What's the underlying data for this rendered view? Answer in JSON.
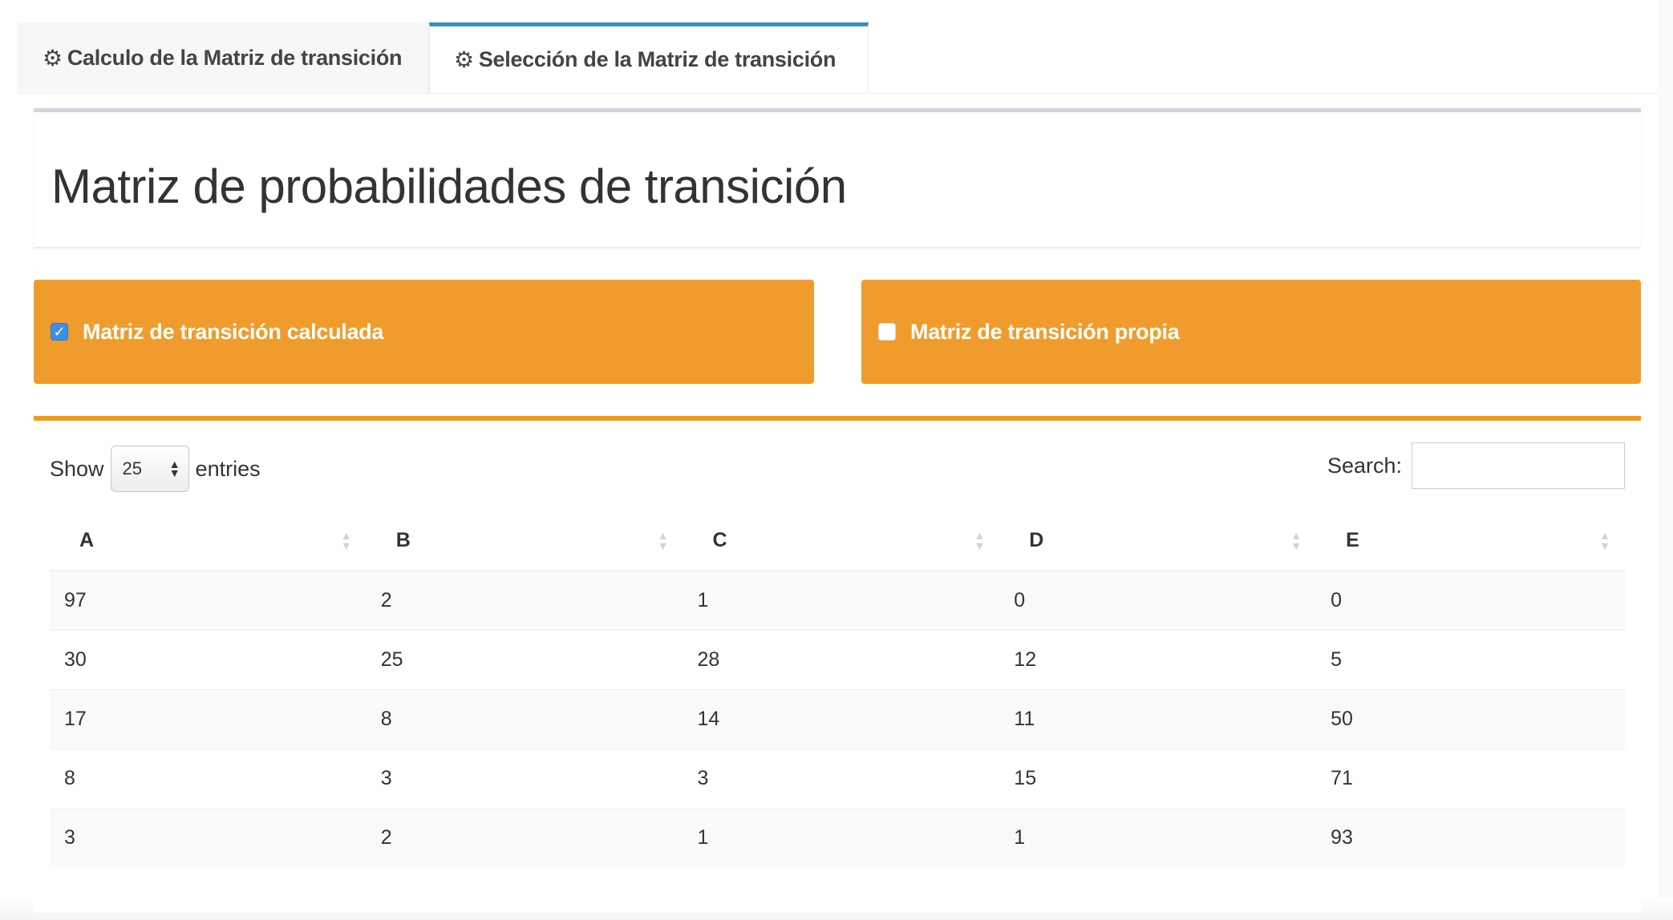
{
  "tabs": [
    {
      "label": "Calculo de la Matriz de transición",
      "icon": "gear-icon",
      "active": false
    },
    {
      "label": "Selección de la Matriz de transición",
      "icon": "gear-icon",
      "active": true
    }
  ],
  "title": "Matriz de probabilidades de transición",
  "options": [
    {
      "label": "Matriz de transición calculada",
      "checked": true
    },
    {
      "label": "Matriz de transición propia",
      "checked": false
    }
  ],
  "table": {
    "show_label": "Show",
    "entries_label": "entries",
    "page_length": "25",
    "search_label": "Search:",
    "search_value": "",
    "columns": [
      "A",
      "B",
      "C",
      "D",
      "E"
    ],
    "rows": [
      [
        "97",
        "2",
        "1",
        "0",
        "0"
      ],
      [
        "30",
        "25",
        "28",
        "12",
        "5"
      ],
      [
        "17",
        "8",
        "14",
        "11",
        "50"
      ],
      [
        "8",
        "3",
        "3",
        "15",
        "71"
      ],
      [
        "3",
        "2",
        "1",
        "1",
        "93"
      ]
    ]
  },
  "colors": {
    "tab_active_border": "#3c8dbc",
    "orange": "#f09c2d",
    "table_border": "#f39c12",
    "checkbox_blue": "#3f8ee6"
  }
}
